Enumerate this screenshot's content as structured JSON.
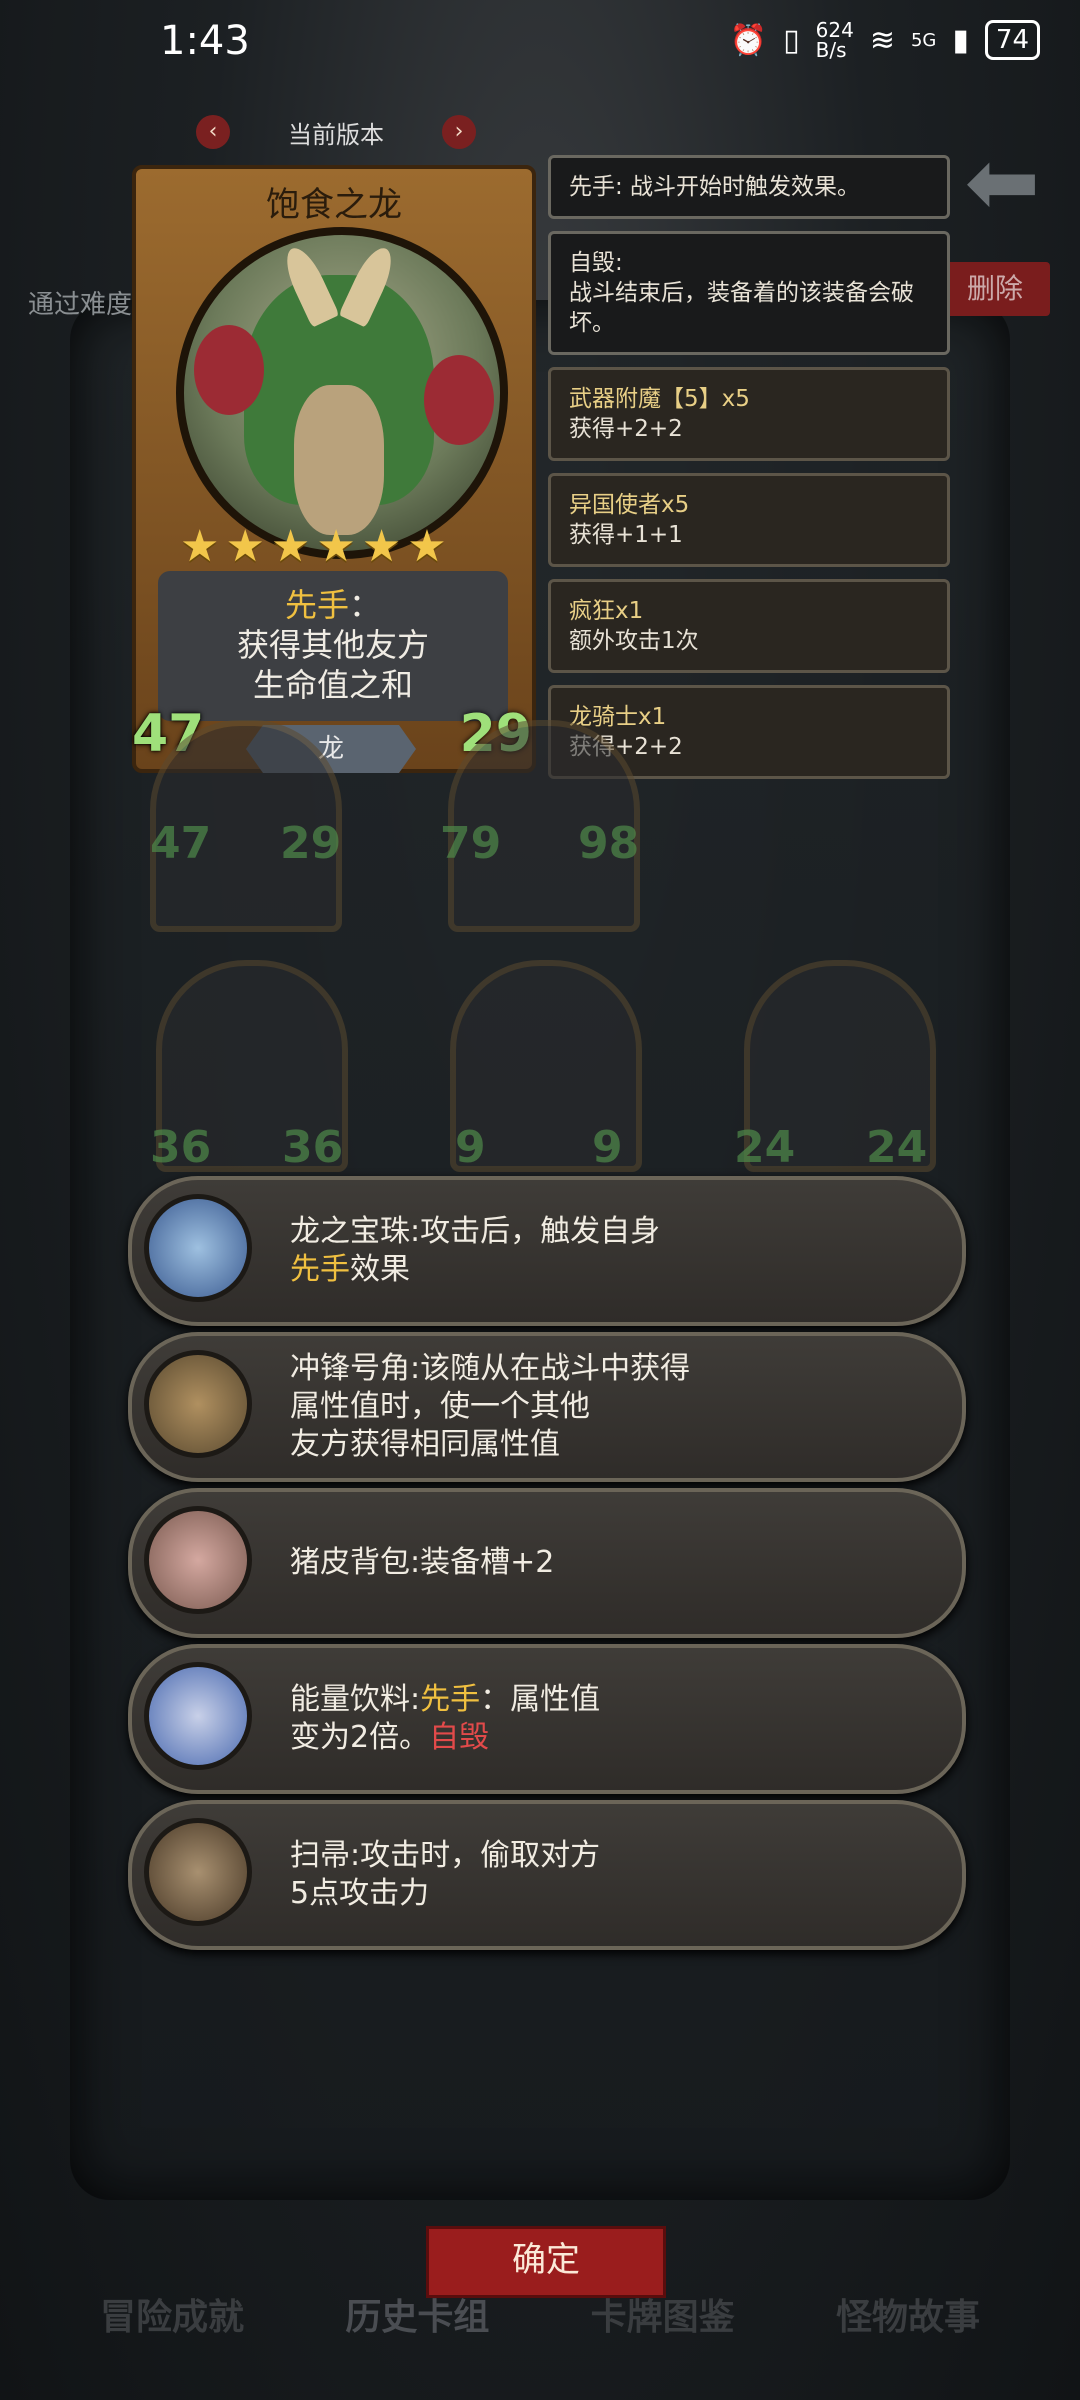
{
  "status_bar": {
    "time": "1:43",
    "network_speed": "624\nB/s",
    "network_type": "5G",
    "battery": "74"
  },
  "background": {
    "left_text": "通过难度",
    "delete_button": "删除"
  },
  "version_nav": {
    "label": "当前版本",
    "prev": "‹",
    "next": "›"
  },
  "card": {
    "name": "饱食之龙",
    "stars": 6,
    "ability_keyword": "先手",
    "ability_colon": "：",
    "ability_line1": "获得其他友方",
    "ability_line2": "生命值之和",
    "attack": "47",
    "health": "29",
    "tribe": "龙"
  },
  "effects": [
    {
      "title": "",
      "text": "先手: 战斗开始时触发效果。"
    },
    {
      "title": "",
      "text": "自毁:\n战斗结束后，装备着的该装备会破坏。"
    },
    {
      "title": "武器附魔【5】x5",
      "text": "获得+2+2"
    },
    {
      "title": "异国使者x5",
      "text": "获得+1+1"
    },
    {
      "title": "疯狂x1",
      "text": "额外攻击1次"
    },
    {
      "title": "龙骑士x1",
      "text": "获得+2+2"
    }
  ],
  "bg_slots": [
    {
      "atk": "47",
      "hp": "29"
    },
    {
      "atk": "79",
      "hp": "98"
    },
    {
      "atk": "36",
      "hp": "36"
    },
    {
      "atk": "9",
      "hp": "9"
    },
    {
      "atk": "24",
      "hp": "24"
    }
  ],
  "items": [
    {
      "icon": "dragon-pearl-icon",
      "line1": "龙之宝珠:攻击后，触发自身",
      "line2_hl": "先手",
      "line2": "效果",
      "line3": ""
    },
    {
      "icon": "charge-horn-icon",
      "line1": "冲锋号角:该随从在战斗中获得",
      "line2_hl": "",
      "line2": "属性值时，使一个其他",
      "line3": "友方获得相同属性值"
    },
    {
      "icon": "pig-backpack-icon",
      "line1": "猪皮背包:装备槽+2",
      "line2_hl": "",
      "line2": "",
      "line3": ""
    },
    {
      "icon": "energy-drink-icon",
      "line1_a": "能量饮料:",
      "line1_hl": "先手",
      "line1_b": "：属性值",
      "line2": "变为2倍。",
      "line2_red": "自毁"
    },
    {
      "icon": "broom-icon",
      "line1": "扫帚:攻击时，偷取对方",
      "line2_hl": "",
      "line2": "5点攻击力",
      "line3": ""
    }
  ],
  "confirm_button": "确定",
  "bottom_tabs": [
    "冒险成就",
    "历史卡组",
    "卡牌图鉴",
    "怪物故事"
  ],
  "colors": {
    "accent_gold": "#f0c040",
    "danger_red": "#e24a4a",
    "confirm_bg": "#9a1d1d"
  }
}
